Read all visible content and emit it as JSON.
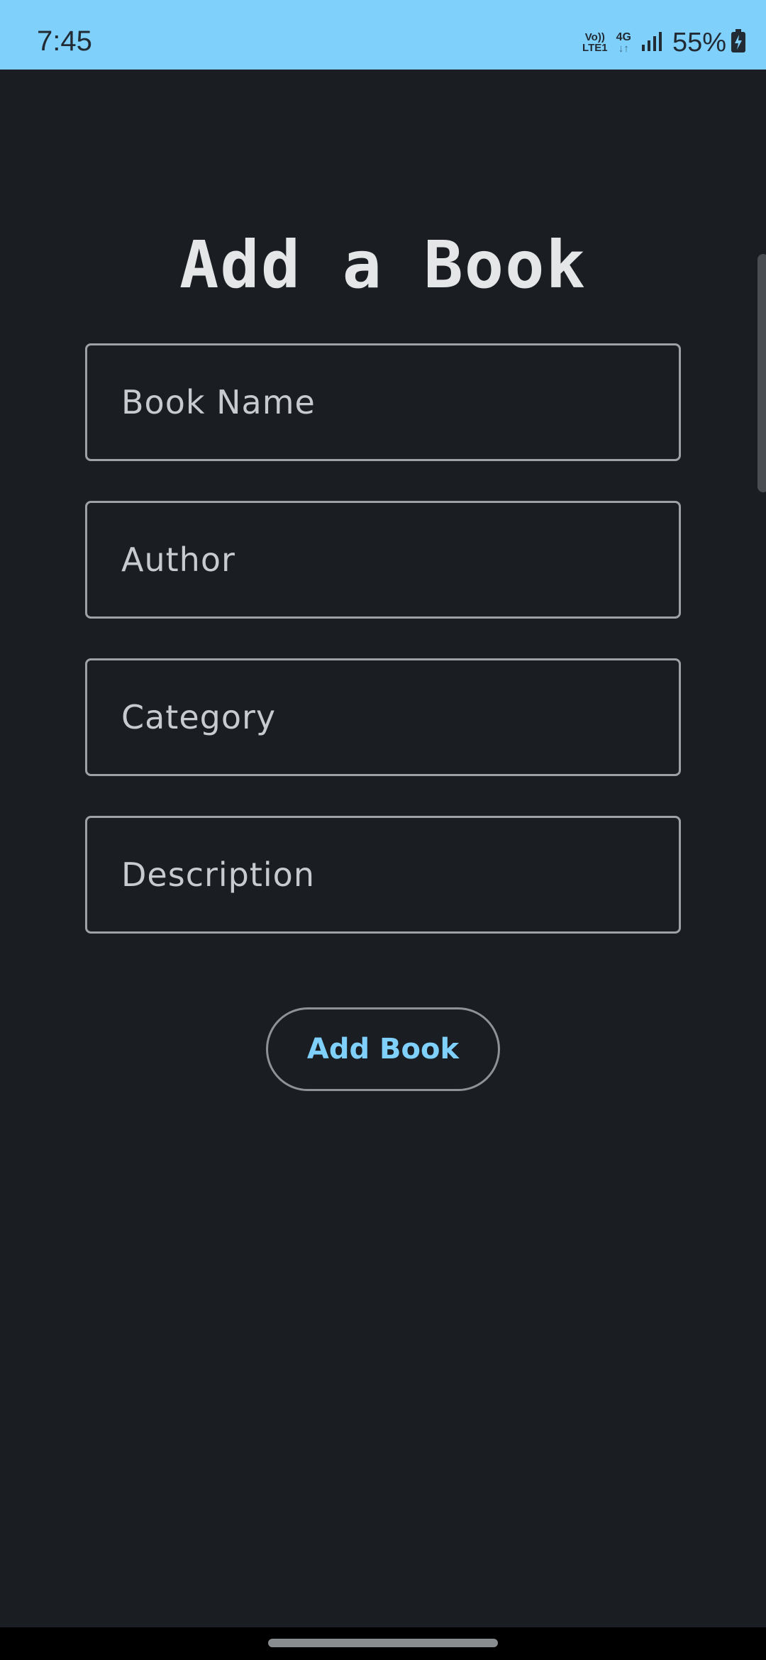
{
  "status_bar": {
    "time": "7:45",
    "volte_top": "Vo))",
    "volte_bottom": "LTE1",
    "network": "4G",
    "network_arrows": "↓↑",
    "battery": "55%",
    "signal_icon": "signal-bars-icon",
    "battery_icon": "battery-charging-icon"
  },
  "page": {
    "title": "Add a Book"
  },
  "form": {
    "book_name": {
      "placeholder": "Book Name",
      "value": ""
    },
    "author": {
      "placeholder": "Author",
      "value": ""
    },
    "category": {
      "placeholder": "Category",
      "value": ""
    },
    "description": {
      "placeholder": "Description",
      "value": ""
    },
    "submit_label": "Add Book"
  },
  "colors": {
    "status_bar_bg": "#7fd0fb",
    "background": "#1a1d21",
    "accent": "#7fd0fb",
    "text": "#e5e6e8",
    "border": "#9ea1a5"
  }
}
